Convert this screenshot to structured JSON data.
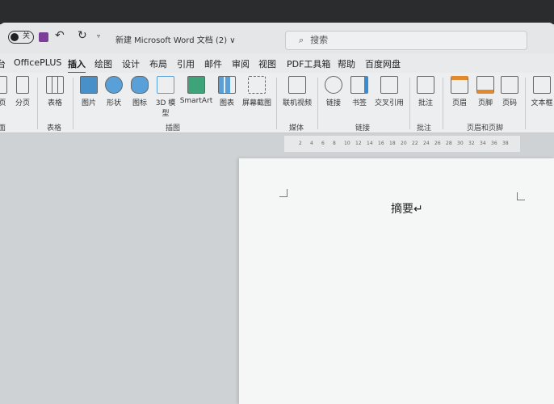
{
  "title_bar": {
    "autosave_state": "关",
    "doc_title": "新建 Microsoft Word 文档 (2) ∨",
    "search_placeholder": "搜索"
  },
  "tabs": [
    "台",
    "OfficePLUS",
    "插入",
    "绘图",
    "设计",
    "布局",
    "引用",
    "邮件",
    "审阅",
    "视图",
    "PDF工具箱",
    "帮助",
    "百度网盘"
  ],
  "active_tab": "插入",
  "ribbon": {
    "buttons": [
      "页",
      "分页",
      "表格",
      "图片",
      "形状",
      "图标",
      "3D 模型",
      "SmartArt",
      "图表",
      "屏幕截图",
      "联机视频",
      "链接",
      "书签",
      "交叉引用",
      "批注",
      "页眉",
      "页脚",
      "页码",
      "文本框"
    ],
    "groups": [
      "面",
      "表格",
      "插图",
      "媒体",
      "链接",
      "批注",
      "页眉和页脚"
    ]
  },
  "ruler_ticks": [
    "2",
    "4",
    "6",
    "8",
    "10",
    "12",
    "14",
    "16",
    "18",
    "20",
    "22",
    "24",
    "26",
    "28",
    "30",
    "32",
    "34",
    "36",
    "38"
  ],
  "document": {
    "text": "摘要↵"
  },
  "colors": {
    "accent": "#2b5797",
    "page": "#f5f6f6"
  }
}
